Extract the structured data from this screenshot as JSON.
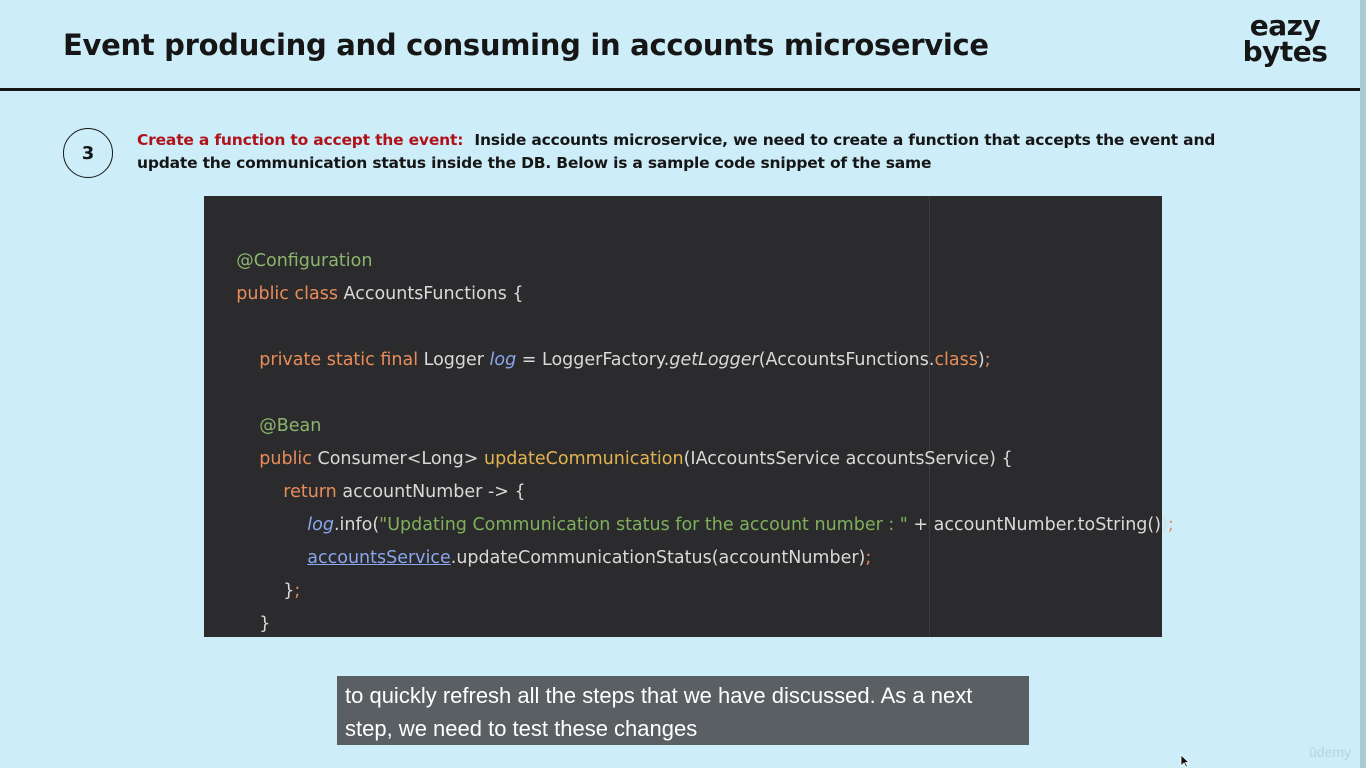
{
  "slide": {
    "title": "Event producing and consuming in accounts microservice",
    "logo": {
      "line1": "eazy",
      "line2": "bytes"
    },
    "step": {
      "number": "3",
      "heading": "Create a function to accept the event:",
      "description": "Inside accounts microservice, we need to create a function that accepts the event and update the communication status inside the DB. Below is a sample code snippet of the same"
    },
    "code": {
      "annotation_configuration": "@Configuration",
      "kw_public": "public",
      "kw_class": "class",
      "class_name": "AccountsFunctions {",
      "kw_private": "private",
      "kw_static": "static",
      "kw_final": "final",
      "logger_type": "Logger",
      "log_field": "log",
      "assign": " = LoggerFactory.",
      "get_logger": "getLogger",
      "get_logger_arg": "(AccountsFunctions.",
      "class_kw": "class",
      "close_paren": ")",
      "semicolon": ";",
      "annotation_bean": "@Bean",
      "consumer_type": "Consumer<Long>",
      "method_name": "updateCommunication",
      "method_params": "(IAccountsService accountsService) {",
      "kw_return": "return",
      "lambda": "accountNumber -> {",
      "info_call": ".info(",
      "log_string": "\"Updating Communication status for the account number : \"",
      "concat": " + accountNumber.toString())",
      "service_field": "accountsService",
      "update_call": ".updateCommunicationStatus(accountNumber)",
      "lambda_close": "}",
      "method_close": "}"
    }
  },
  "caption": {
    "line1": "to quickly refresh all the steps that we have discussed. As a next",
    "line2": "step, we need to test these changes"
  },
  "watermark": "ûdemy"
}
